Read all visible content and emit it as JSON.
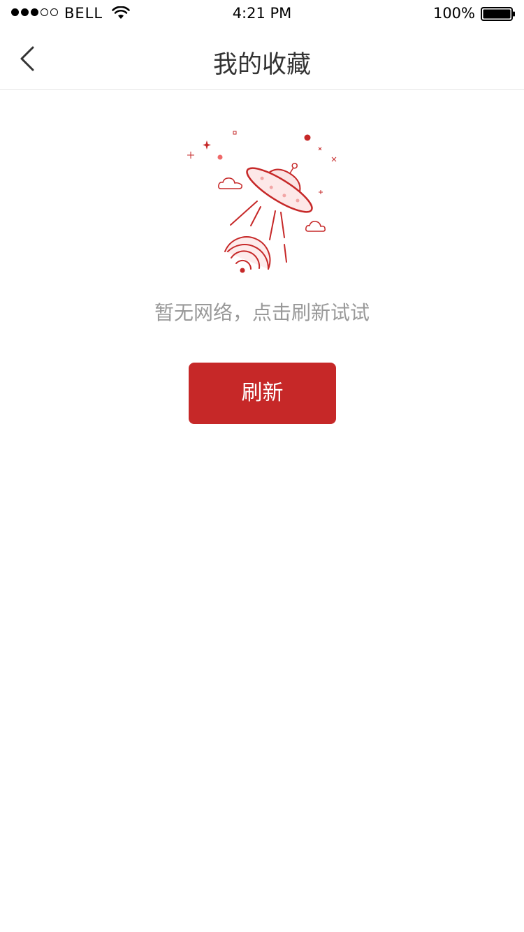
{
  "status_bar": {
    "carrier": "BELL",
    "time": "4:21 PM",
    "battery": "100%",
    "signal_bars_filled": 3,
    "signal_bars_total": 5
  },
  "nav": {
    "title": "我的收藏",
    "back_icon": "chevron-left-icon"
  },
  "empty_state": {
    "illustration": "ufo-no-network-illustration",
    "message": "暂无网络，点击刷新试试",
    "refresh_label": "刷新"
  },
  "colors": {
    "accent": "#c62828",
    "title_text": "#333333",
    "message_text": "#999999",
    "divider": "#e6e6e6"
  }
}
